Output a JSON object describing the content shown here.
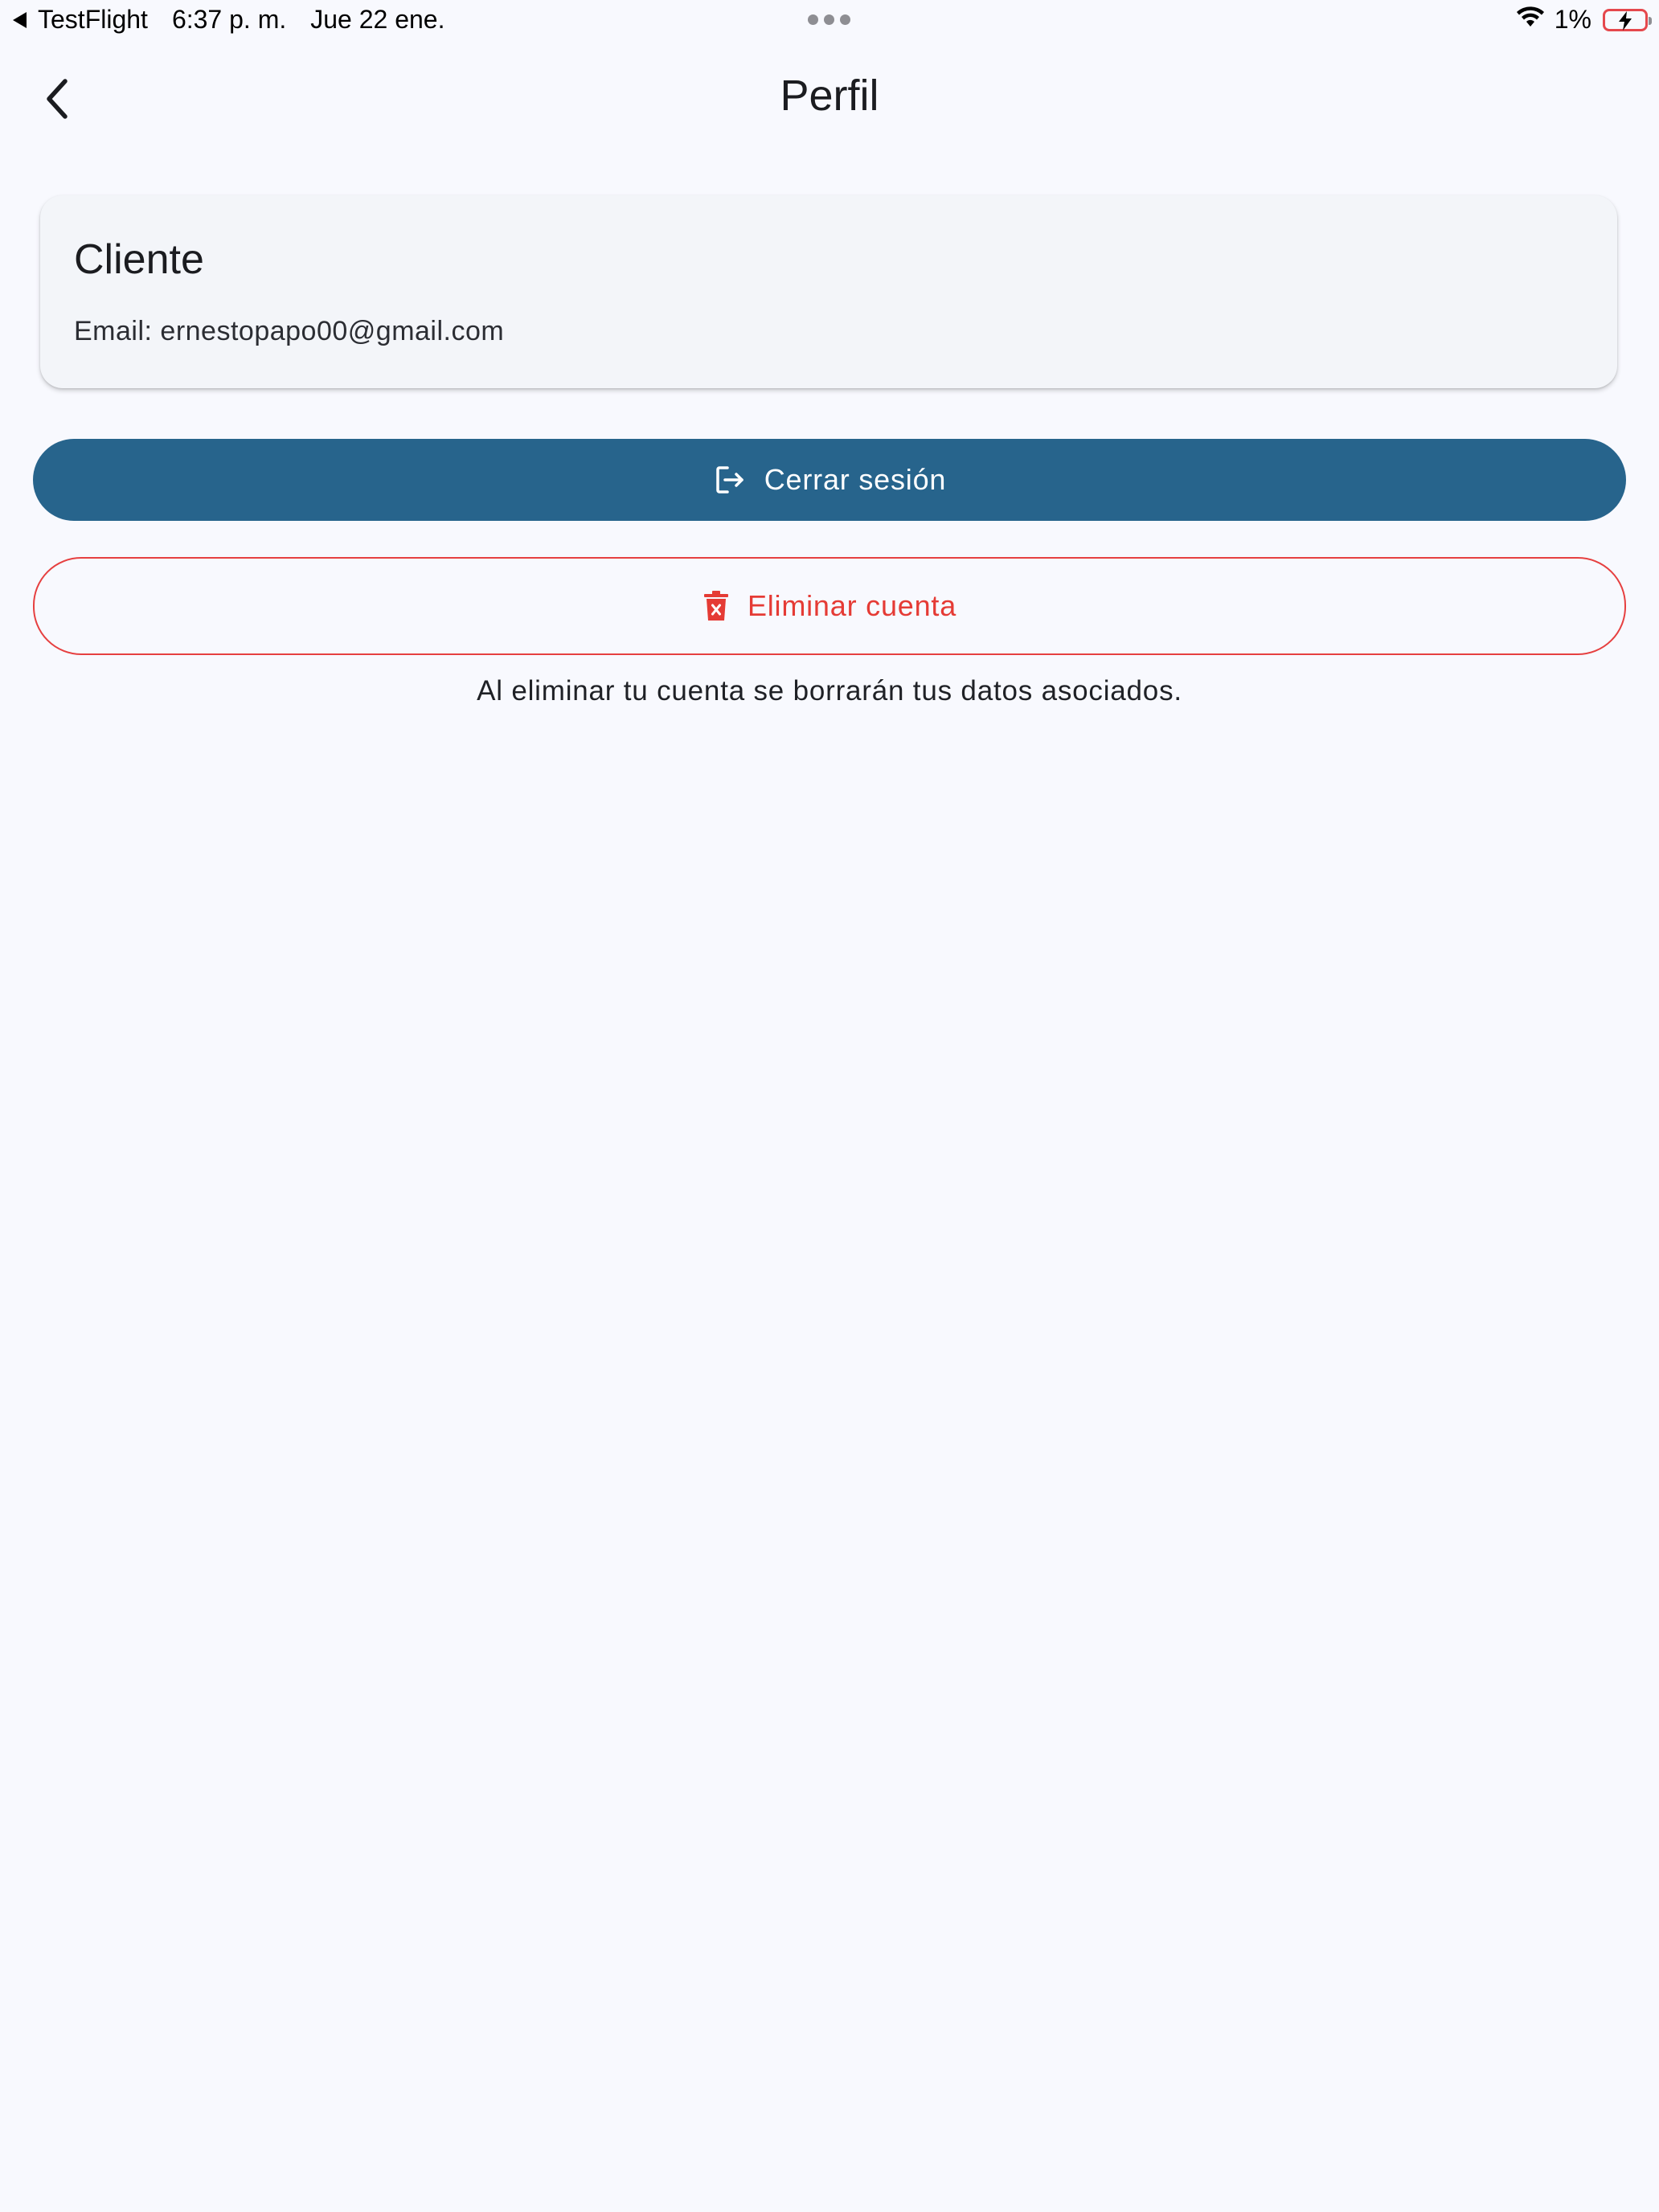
{
  "status_bar": {
    "back_app": "TestFlight",
    "time": "6:37 p. m.",
    "date": "Jue 22 ene.",
    "battery": "1%"
  },
  "app_bar": {
    "title": "Perfil"
  },
  "profile": {
    "name": "Cliente",
    "email_line": "Email: ernestopapo00@gmail.com"
  },
  "actions": {
    "logout_label": "Cerrar sesión",
    "delete_label": "Eliminar cuenta",
    "delete_note": "Al eliminar tu cuenta se borrarán tus datos asociados."
  },
  "colors": {
    "background": "#f8f9fe",
    "primary": "#27648c",
    "danger": "#e53b35",
    "card": "#f3f5f9"
  },
  "icons": {
    "back": "chevron-left-icon",
    "logout": "logout-icon",
    "delete": "trash-icon"
  }
}
